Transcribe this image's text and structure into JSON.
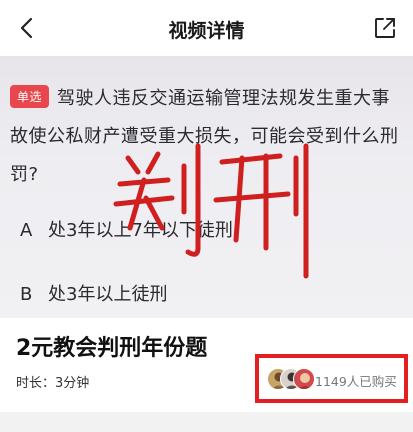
{
  "navbar": {
    "title": "视频详情"
  },
  "question": {
    "badge": "单选",
    "line1": "驾驶人违反交通运输管理法规发生重大事",
    "line2": "故使公私财产遭受重大损失，可能会受到什么刑",
    "line3": "罚?",
    "options": [
      {
        "letter": "A",
        "text": "处3年以上7年以下徒刑"
      },
      {
        "letter": "B",
        "text": "处3年以上徒刑"
      }
    ],
    "handwriting": "判刑"
  },
  "video_info": {
    "title": "2元教会判刑年份题",
    "duration": "时长：3分钟",
    "buyers": "1149人已购买"
  },
  "colors": {
    "accent_red": "#e31f1f",
    "badge_red": "#e8484d",
    "handwriting_red": "#cf1f1f"
  }
}
